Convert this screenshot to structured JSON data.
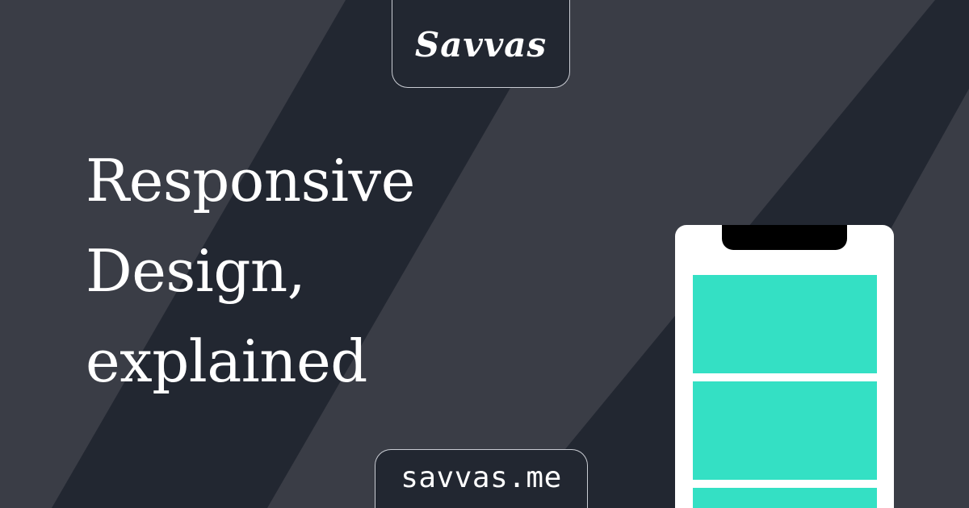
{
  "brand": {
    "logo_text": "Savvas"
  },
  "headline": {
    "lines": [
      "Responsive",
      "Design,",
      "explained"
    ]
  },
  "footer": {
    "url": "savvas.me"
  },
  "colors": {
    "background": "#3a3d46",
    "stripe": "#222731",
    "badge_background": "#222731",
    "badge_border": "#c9ccd3",
    "text": "#ffffff",
    "phone_body": "#ffffff",
    "phone_notch": "#000000",
    "accent": "#34e0c4"
  },
  "icons": {
    "phone": "phone-illustration"
  }
}
